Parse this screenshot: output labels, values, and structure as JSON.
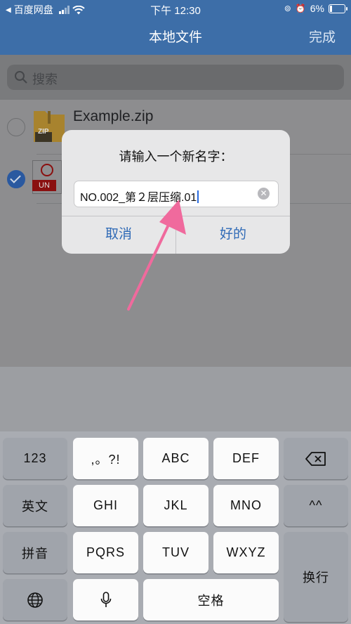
{
  "status_bar": {
    "back_app": "百度网盘",
    "time": "下午 12:30",
    "battery": "6%"
  },
  "nav": {
    "title": "本地文件",
    "done": "完成"
  },
  "search": {
    "placeholder": "搜索"
  },
  "files": [
    {
      "name": "Example.zip",
      "badge": "ZIP",
      "selected": false
    },
    {
      "name": "",
      "badge": "UN",
      "selected": true
    }
  ],
  "dialog": {
    "title": "请输入一个新名字：",
    "input_value": "NO.002_第２层压缩.01",
    "cancel": "取消",
    "ok": "好的"
  },
  "keyboard": {
    "row1": [
      "123",
      ",。?!",
      "ABC",
      "DEF"
    ],
    "row2": [
      "英文",
      "GHI",
      "JKL",
      "MNO",
      "^^"
    ],
    "row3": [
      "拼音",
      "PQRS",
      "TUV",
      "WXYZ"
    ],
    "row4_space": "空格",
    "return": "换行"
  },
  "colors": {
    "nav_bar": "#3d6ea8",
    "accent_arrow": "#f06a9d",
    "link": "#2f6ab6"
  }
}
